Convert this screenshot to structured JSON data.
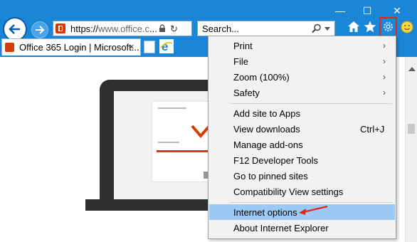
{
  "window": {
    "minimize": "—",
    "maximize": "☐",
    "close": "✕"
  },
  "address_bar": {
    "url_main": "https://",
    "url_domain": "www.office.c",
    "url_rest": "..."
  },
  "search_box": {
    "placeholder": "Search..."
  },
  "tab": {
    "title": "Office 365 Login | Microsoft...",
    "close": "×"
  },
  "menu": {
    "items": [
      {
        "label": "Print",
        "submenu": true
      },
      {
        "label": "File",
        "submenu": true
      },
      {
        "label": "Zoom (100%)",
        "submenu": true
      },
      {
        "label": "Safety",
        "submenu": true
      },
      {
        "label": "Add site to Apps"
      },
      {
        "label": "View downloads",
        "shortcut": "Ctrl+J"
      },
      {
        "label": "Manage add-ons"
      },
      {
        "label": "F12 Developer Tools"
      },
      {
        "label": "Go to pinned sites"
      },
      {
        "label": "Compatibility View settings"
      },
      {
        "label": "Internet options",
        "highlighted": true
      },
      {
        "label": "About Internet Explorer"
      }
    ],
    "arrow_glyph": "›"
  },
  "colors": {
    "chrome_blue": "#1a86d8",
    "highlight": "#9ccaf5",
    "office_orange": "#d83b01",
    "annotation_red": "#e0271a"
  },
  "icons": [
    "back-arrow-icon",
    "forward-arrow-icon",
    "lock-icon",
    "refresh-icon",
    "search-icon",
    "home-icon",
    "favorites-star-icon",
    "gear-icon",
    "smiley-feedback-icon",
    "ie-logo-icon"
  ]
}
